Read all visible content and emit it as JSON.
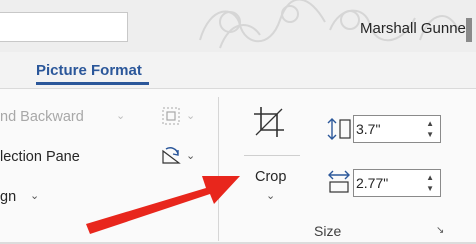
{
  "title_bar": {
    "user_name": "Marshall Gunnell"
  },
  "tabs": {
    "active_label": "Picture Format"
  },
  "arrange_group": {
    "send_backward_label": "nd Backward",
    "selection_pane_label": "lection Pane",
    "align_label": "gn",
    "chevron": "⌄"
  },
  "crop": {
    "label": "Crop",
    "chevron": "⌄"
  },
  "size_group": {
    "height_value": "3.7\"",
    "width_value": "2.77\"",
    "label": "Size",
    "spin_up": "▲",
    "spin_down": "▼",
    "launcher": "↘"
  },
  "colors": {
    "accent": "#2b579a",
    "arrow": "#e8261c"
  }
}
